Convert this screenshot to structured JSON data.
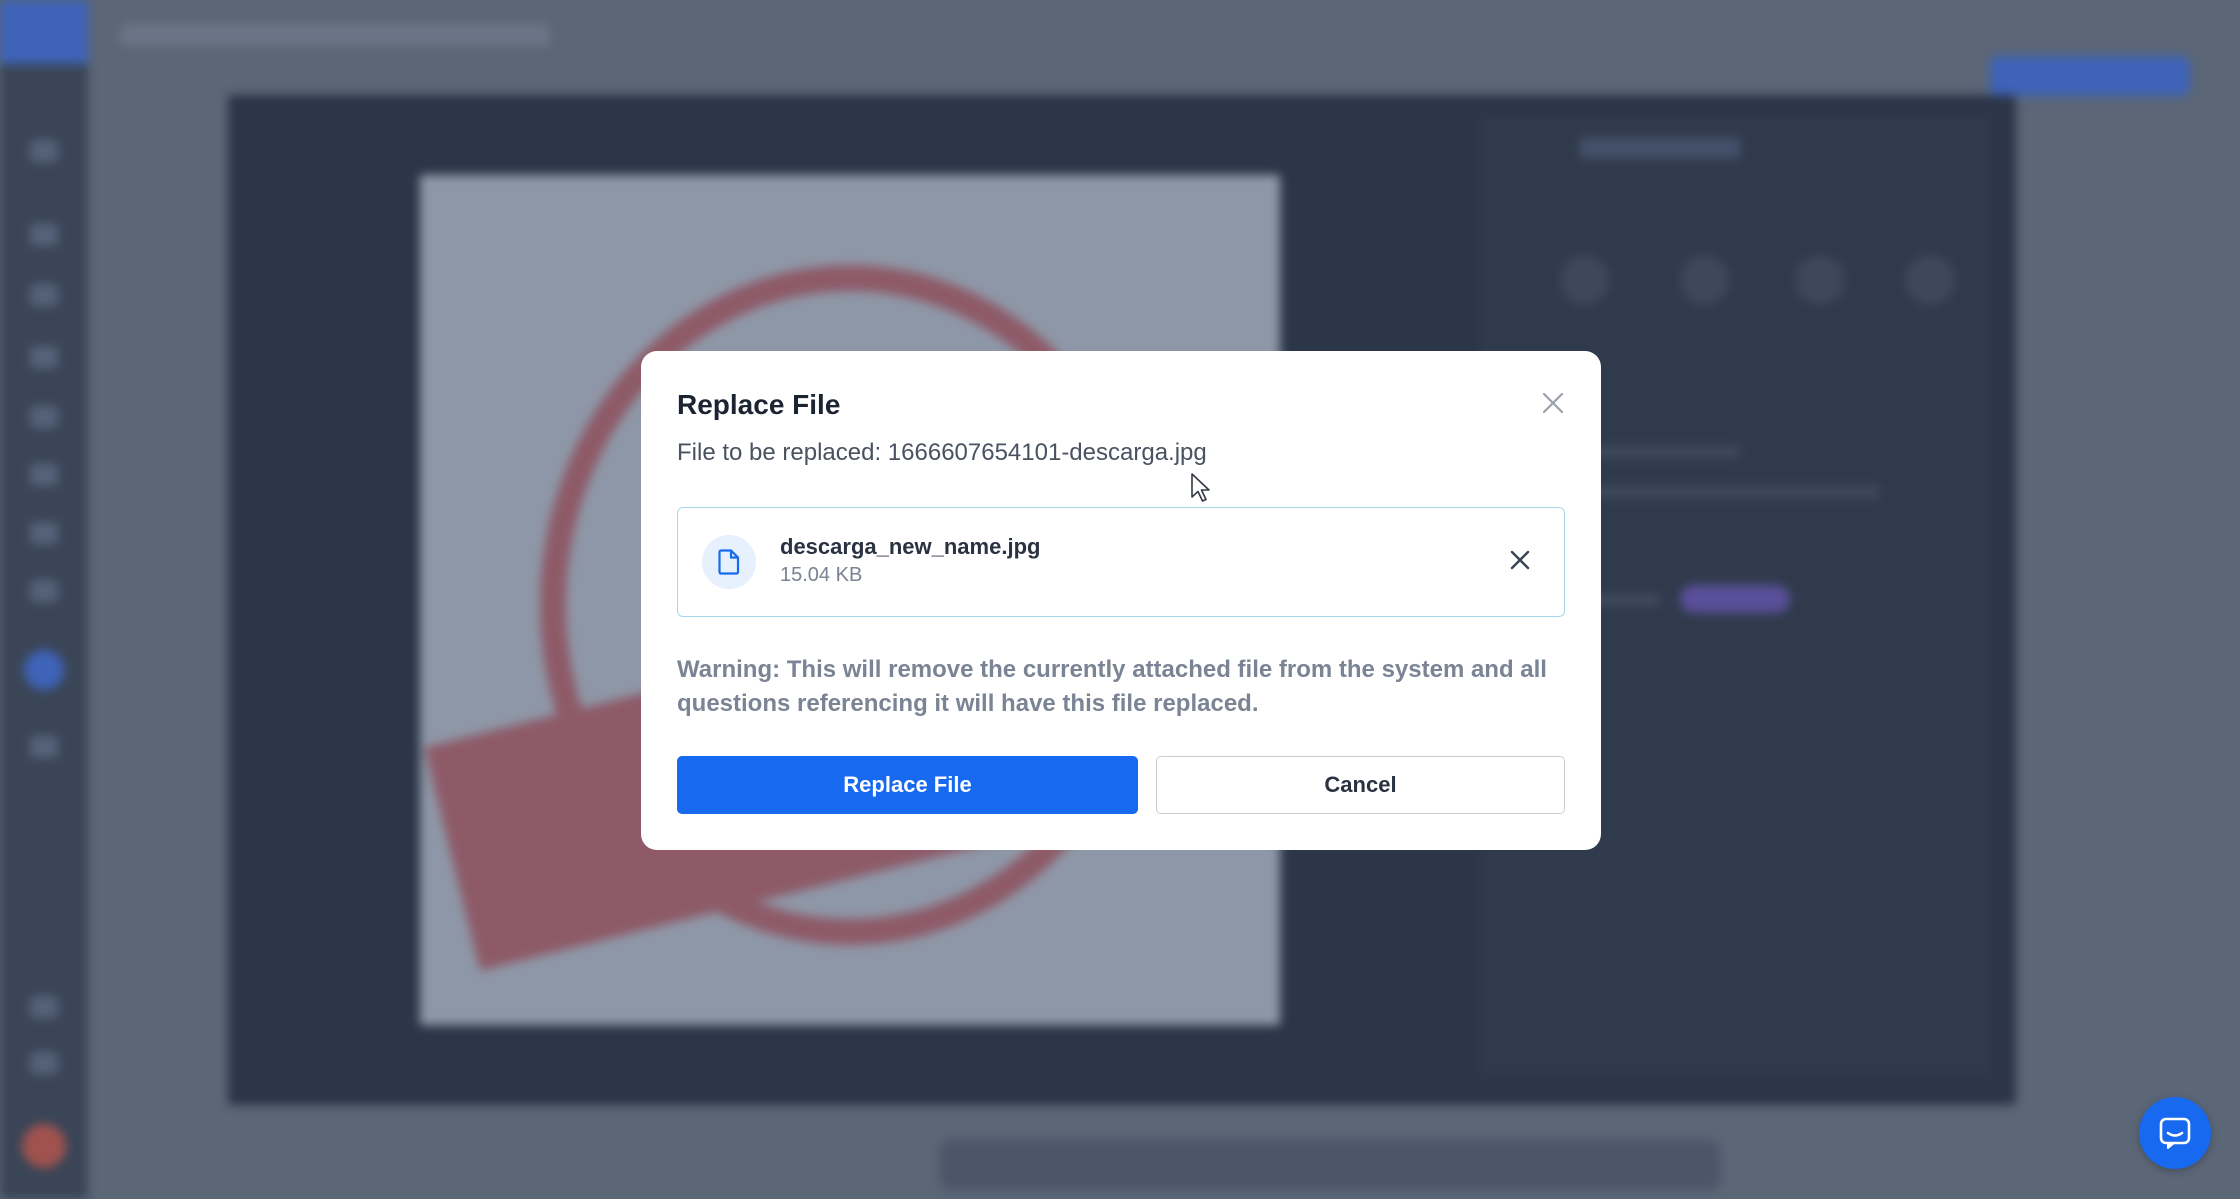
{
  "dialog": {
    "title": "Replace File",
    "subtitle_prefix": "File to be replaced:",
    "subtitle_file": "1666607654101-descarga.jpg",
    "file": {
      "name": "descarga_new_name.jpg",
      "size": "15.04 KB",
      "icon": "file-icon"
    },
    "warning": "Warning: This will remove the currently attached file from the system and all questions referencing it will have this file replaced.",
    "primary_button": "Replace File",
    "secondary_button": "Cancel"
  },
  "colors": {
    "primary": "#1769f0",
    "overlay": "#5b6677",
    "card_border": "#a9d6ec",
    "warning_text": "#7b8494"
  },
  "icons": {
    "close": "close-icon",
    "remove": "x-icon",
    "chat": "chat-bubble-icon",
    "cursor": "mouse-pointer-icon"
  }
}
